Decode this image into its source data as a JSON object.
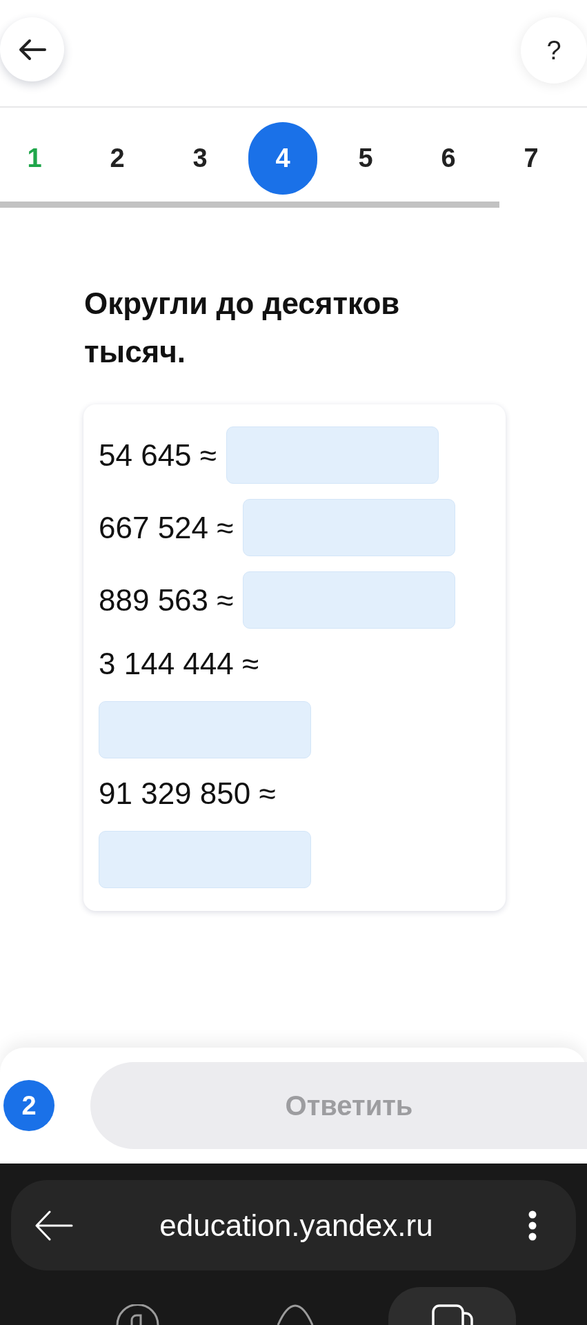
{
  "header": {
    "help_label": "?"
  },
  "tabs": [
    {
      "label": "1",
      "selected": false,
      "correct": true
    },
    {
      "label": "2",
      "selected": false,
      "correct": false
    },
    {
      "label": "3",
      "selected": false,
      "correct": false
    },
    {
      "label": "4",
      "selected": true,
      "correct": false
    },
    {
      "label": "5",
      "selected": false,
      "correct": false
    },
    {
      "label": "6",
      "selected": false,
      "correct": false
    },
    {
      "label": "7",
      "selected": false,
      "correct": false
    }
  ],
  "task": {
    "title": "Округли до десятков тысяч.",
    "items": [
      {
        "expression": "54 645 ≈"
      },
      {
        "expression": "667 524 ≈"
      },
      {
        "expression": "889 563 ≈"
      },
      {
        "expression": "3 144 444 ≈"
      },
      {
        "expression": "91 329 850 ≈"
      }
    ]
  },
  "footer": {
    "badge": "2",
    "answer_button": {
      "label": "Ответить",
      "disabled": true
    }
  },
  "browser": {
    "url": "education.yandex.ru",
    "nav": [
      {
        "kind": "logo",
        "selected": false
      },
      {
        "kind": "assistant",
        "selected": false
      },
      {
        "kind": "tabs",
        "selected": true
      }
    ]
  }
}
